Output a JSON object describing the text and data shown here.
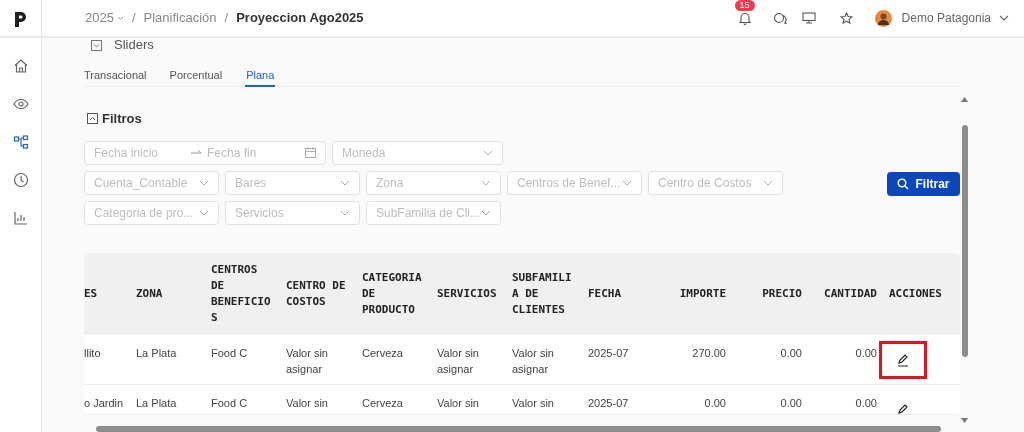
{
  "breadcrumb": {
    "separator": "/",
    "items": [
      {
        "text": "2025",
        "dropdown": true,
        "current": false
      },
      {
        "text": "Planificación",
        "dropdown": false,
        "current": false
      },
      {
        "text": "Proyeccion Ago2025",
        "dropdown": false,
        "current": true
      }
    ]
  },
  "topbar": {
    "notification_count": "15",
    "user": "Demo Patagonia"
  },
  "sidebar": {
    "items": [
      {
        "kind": "home",
        "selected": false
      },
      {
        "kind": "eye",
        "selected": false
      },
      {
        "kind": "diagram",
        "selected": true
      },
      {
        "kind": "clock",
        "selected": false
      },
      {
        "kind": "chart",
        "selected": false
      }
    ]
  },
  "section": {
    "title": "Sliders",
    "expanded": false
  },
  "tabs": [
    {
      "label": "Transacional",
      "selected": false
    },
    {
      "label": "Porcentual",
      "selected": false
    },
    {
      "label": "Plana",
      "selected": true
    }
  ],
  "filters": {
    "title": "Filtros",
    "expanded": true,
    "date_range": {
      "start_placeholder": "Fecha inicio",
      "end_placeholder": "Fecha fin"
    },
    "rows": [
      [
        "Moneda"
      ],
      [
        "Cuenta_Contable",
        "Bares",
        "Zona",
        "Centros de Benef...",
        "Centro de Costos"
      ],
      [
        "Categoria de pro...",
        "Servicios",
        "SubFamilia de Cli..."
      ]
    ],
    "button": "Filtrar"
  },
  "table": {
    "columns": [
      {
        "label": "ES",
        "kind": "text"
      },
      {
        "label": "ZONA",
        "kind": "text"
      },
      {
        "label": "CENTROS DE BENEFICIOS",
        "kind": "text"
      },
      {
        "label": "CENTRO DE COSTOS",
        "kind": "text"
      },
      {
        "label": "CATEGORIA DE PRODUCTO",
        "kind": "text"
      },
      {
        "label": "SERVICIOS",
        "kind": "text"
      },
      {
        "label": "SUBFAMILIA DE CLIENTES",
        "kind": "text"
      },
      {
        "label": "FECHA",
        "kind": "text"
      },
      {
        "label": "IMPORTE",
        "kind": "number"
      },
      {
        "label": "PRECIO",
        "kind": "number"
      },
      {
        "label": "CANTIDAD",
        "kind": "number"
      },
      {
        "label": "ACCIONES",
        "kind": "actions"
      }
    ],
    "rows": [
      {
        "highlighted": true,
        "cells": [
          "llito",
          "La Plata",
          "Food C",
          "Valor sin asignar",
          "Cerveza",
          "Valor sin asignar",
          "Valor sin asignar",
          "2025-07",
          "270.00",
          "0.00",
          "0.00"
        ]
      },
      {
        "highlighted": false,
        "cells": [
          "o Jardin",
          "La Plata",
          "Food C",
          "Valor sin",
          "Cerveza",
          "Valor sin",
          "Valor sin",
          "2025-07",
          "0.00",
          "0.00",
          "0.00"
        ]
      }
    ]
  }
}
